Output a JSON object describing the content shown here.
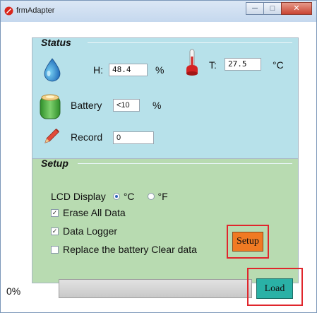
{
  "window": {
    "title": "frmAdapter",
    "controls": {
      "minimize": "─",
      "maximize": "□",
      "close": "✕"
    }
  },
  "status": {
    "legend": "Status",
    "humidity": {
      "label": "H:",
      "value": "48.4",
      "unit": "%"
    },
    "temperature": {
      "label": "T:",
      "value": "27.5",
      "unit": "°C"
    },
    "battery": {
      "label": "Battery",
      "value": "<10",
      "unit": "%"
    },
    "record": {
      "label": "Record",
      "value": "0"
    }
  },
  "setup": {
    "legend": "Setup",
    "lcd_display": {
      "label": "LCD Display",
      "options": [
        {
          "label": "°C",
          "selected": true
        },
        {
          "label": "°F",
          "selected": false
        }
      ]
    },
    "checkboxes": [
      {
        "label": "Erase All Data",
        "checked": true
      },
      {
        "label": "Data Logger",
        "checked": true
      },
      {
        "label": "Replace the battery Clear data",
        "checked": false
      }
    ],
    "button_label": "Setup"
  },
  "progress": {
    "label": "0%",
    "fraction": 0
  },
  "load_button_label": "Load",
  "colors": {
    "status_bg": "#b7e1ea",
    "setup_bg": "#b8dbb1",
    "setup_button": "#f07a23",
    "load_button": "#2ab1a6",
    "highlight": "#e0262c"
  },
  "icons": [
    "water-drop-icon",
    "thermometer-icon",
    "battery-icon",
    "pencil-icon",
    "app-icon"
  ]
}
